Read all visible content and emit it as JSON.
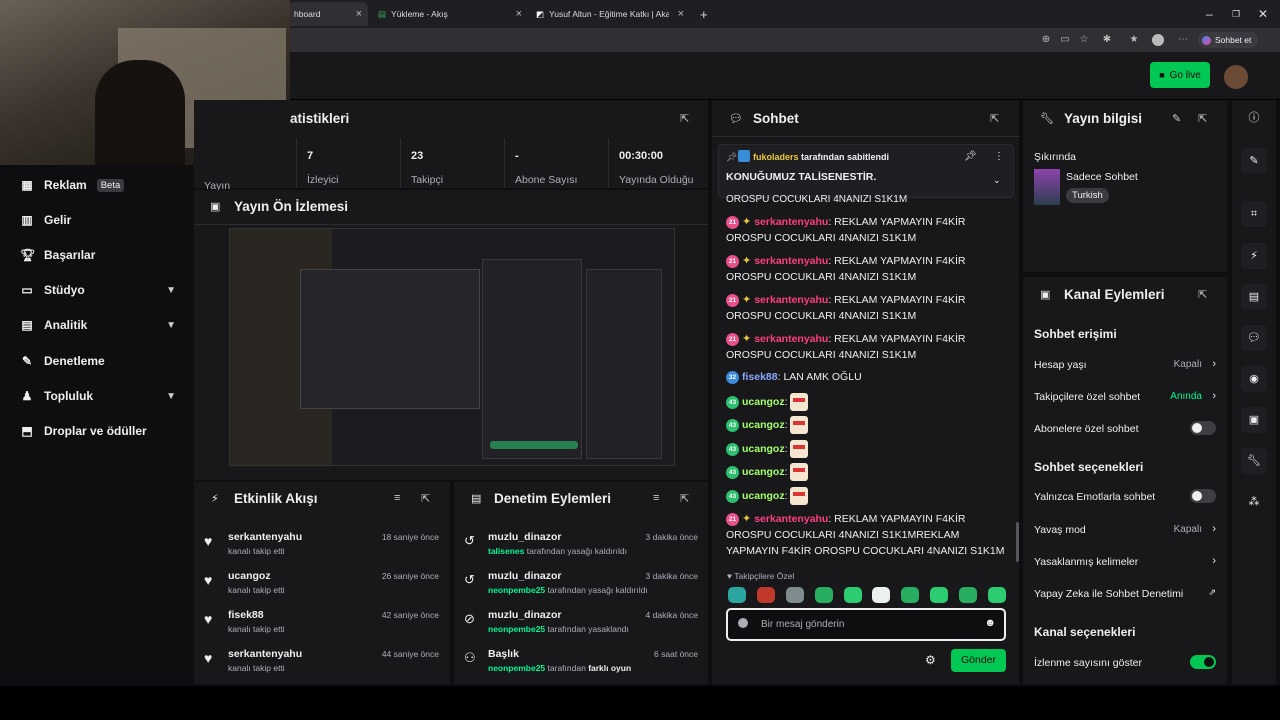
{
  "browser": {
    "tabs": [
      {
        "label": "hboard"
      },
      {
        "label": "Yükleme - Akış"
      },
      {
        "label": "Yusuf Altun - Eğitime Katkı | Akade"
      }
    ],
    "new_tab": "+",
    "profile_button": "Sohbet et"
  },
  "header": {
    "go_live": "Go live"
  },
  "stats": {
    "title": "atistikleri",
    "cells": [
      {
        "value": "",
        "label": "Yayın"
      },
      {
        "value": "7",
        "label": "İzleyici"
      },
      {
        "value": "23",
        "label": "Takipçi"
      },
      {
        "value": "-",
        "label": "Abone Sayısı"
      },
      {
        "value": "00:30:00",
        "label": "Yayında Olduğu"
      }
    ]
  },
  "preview": {
    "title": "Yayın Ön İzlemesi"
  },
  "sidebar": {
    "items": [
      {
        "label": "Reklam",
        "badge": "Beta"
      },
      {
        "label": "Gelir"
      },
      {
        "label": "Başarılar"
      },
      {
        "label": "Stüdyo"
      },
      {
        "label": "Analitik"
      },
      {
        "label": "Denetleme"
      },
      {
        "label": "Topluluk"
      },
      {
        "label": "Droplar ve ödüller"
      }
    ]
  },
  "activity": {
    "title": "Etkinlik Akışı",
    "rows": [
      {
        "name": "serkantenyahu",
        "sub": "kanalı takip etti",
        "time": "18 saniye önce"
      },
      {
        "name": "ucangoz",
        "sub": "kanalı takip etti",
        "time": "26 saniye önce"
      },
      {
        "name": "fisek88",
        "sub": "kanalı takip etti",
        "time": "42 saniye önce"
      },
      {
        "name": "serkantenyahu",
        "sub": "kanalı takip etti",
        "time": "44 saniye önce"
      }
    ]
  },
  "moderation": {
    "title": "Denetim Eylemleri",
    "rows": [
      {
        "name": "muzlu_dinazor",
        "actor": "talisenes",
        "sub": "tarafından yasağı kaldırıldı",
        "time": "3 dakika önce"
      },
      {
        "name": "muzlu_dinazor",
        "actor": "neonpembe25",
        "sub": "tarafından yasağı kaldırıldı",
        "time": "3 dakika önce"
      },
      {
        "name": "muzlu_dinazor",
        "actor": "neonpembe25",
        "sub": "tarafından yasaklandı",
        "time": "4 dakika önce"
      },
      {
        "name": "Başlık",
        "actor": "neonpembe25",
        "sub": "tarafından",
        "extra": "farklı oyun",
        "time": "6 saat önce"
      }
    ]
  },
  "chat": {
    "title": "Sohbet",
    "pinned_by": "fukoladers",
    "pinned_suffix": "tarafından sabitlendi",
    "pinned_message": "KONUĞUMUZ TALİSENESTİR.",
    "partial_line": "OROSPU COCUKLARI 4NANIZI S1K1M",
    "messages": [
      {
        "badge": "21",
        "user": "serkantenyahu",
        "text": ": REKLAM YAPMAYIN F4KİR OROSPU COCUKLARI 4NANIZI S1K1M"
      },
      {
        "badge": "21",
        "user": "serkantenyahu",
        "text": ": REKLAM YAPMAYIN F4KİR OROSPU COCUKLARI 4NANIZI S1K1M"
      },
      {
        "badge": "21",
        "user": "serkantenyahu",
        "text": ": REKLAM YAPMAYIN F4KİR OROSPU COCUKLARI 4NANIZI S1K1M"
      },
      {
        "badge": "21",
        "user": "serkantenyahu",
        "text": ": REKLAM YAPMAYIN F4KİR OROSPU COCUKLARI 4NANIZI S1K1M"
      },
      {
        "badge": "32",
        "user": "fisek88",
        "text": ": LAN AMK OĞLU"
      },
      {
        "badge": "43",
        "user": "ucangoz",
        "text": ":"
      },
      {
        "badge": "43",
        "user": "ucangoz",
        "text": ":"
      },
      {
        "badge": "43",
        "user": "ucangoz",
        "text": ":"
      },
      {
        "badge": "43",
        "user": "ucangoz",
        "text": ":"
      },
      {
        "badge": "43",
        "user": "ucangoz",
        "text": ":"
      },
      {
        "badge": "21",
        "user": "serkantenyahu",
        "text": ": REKLAM YAPMAYIN F4KİR OROSPU COCUKLARI 4NANIZI S1K1MREKLAM YAPMAYIN F4KİR OROSPU COCUKLARI 4NANIZI S1K1M"
      }
    ],
    "emote_section": "Takipçilere Özel",
    "input_placeholder": "Bir mesaj gönderin",
    "send": "Gönder"
  },
  "stream_info": {
    "title": "Yayın bilgisi",
    "live_label": "Şıkırında",
    "category": "Sadece Sohbet",
    "tag": "Turkish"
  },
  "channel_actions": {
    "title": "Kanal Eylemleri",
    "chat_access": "Sohbet erişimi",
    "account_age": {
      "label": "Hesap yaşı",
      "value": "Kapalı"
    },
    "followers_only": {
      "label": "Takipçilere özel sohbet",
      "value": "Anında"
    },
    "subs_only": {
      "label": "Abonelere özel sohbet",
      "enabled": false
    },
    "chat_options": "Sohbet seçenekleri",
    "emote_only": {
      "label": "Yalnızca Emotlarla sohbet",
      "enabled": false
    },
    "slow_mode": {
      "label": "Yavaş mod",
      "value": "Kapalı"
    },
    "banned_words": {
      "label": "Yasaklanmış kelimeler"
    },
    "ai_mod": {
      "label": "Yapay Zeka ile Sohbet Denetimi"
    },
    "channel_options": "Kanal seçenekleri",
    "viewer_count": {
      "label": "İzlenme sayısını göster",
      "enabled": true
    }
  },
  "colors": {
    "accent": "#00f593",
    "go_live": "#00c853",
    "panel": "#18181b",
    "bg": "#0e0e10"
  }
}
